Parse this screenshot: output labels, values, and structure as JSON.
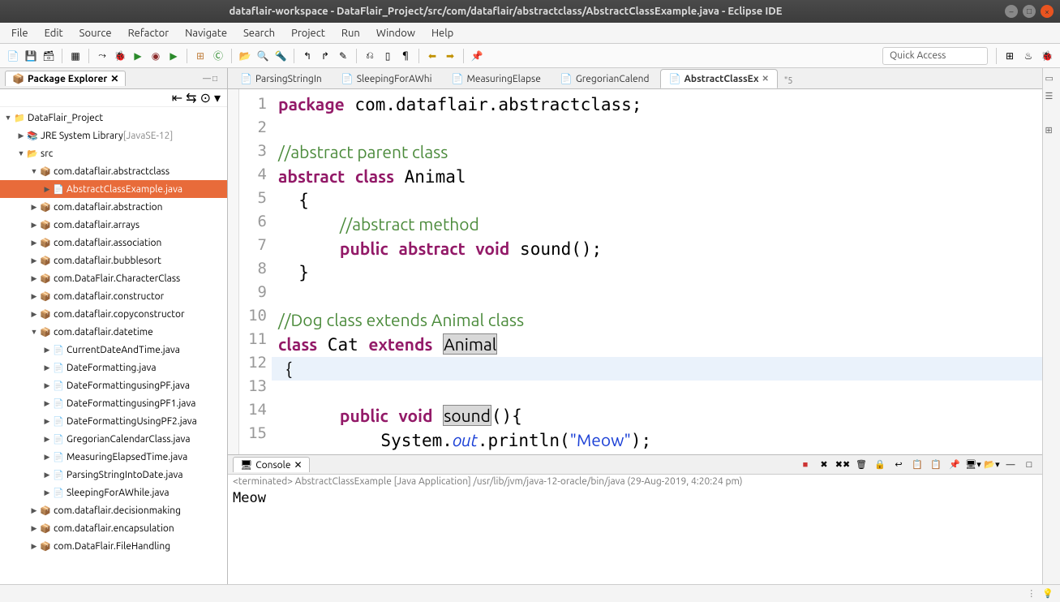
{
  "title": "dataflair-workspace - DataFlair_Project/src/com/dataflair/abstractclass/AbstractClassExample.java - Eclipse IDE",
  "menu": [
    "File",
    "Edit",
    "Source",
    "Refactor",
    "Navigate",
    "Search",
    "Project",
    "Run",
    "Window",
    "Help"
  ],
  "quick_access_placeholder": "Quick Access",
  "package_explorer": {
    "title": "Package Explorer",
    "tree": [
      {
        "d": 0,
        "tw": "▼",
        "ic": "prj",
        "label": "DataFlair_Project"
      },
      {
        "d": 1,
        "tw": "▶",
        "ic": "lib",
        "label": "JRE System Library ",
        "suffix": "[JavaSE-12]"
      },
      {
        "d": 1,
        "tw": "▼",
        "ic": "src",
        "label": "src"
      },
      {
        "d": 2,
        "tw": "▼",
        "ic": "pkg",
        "label": "com.dataflair.abstractclass"
      },
      {
        "d": 3,
        "tw": "▶",
        "ic": "java",
        "label": "AbstractClassExample.java",
        "sel": true
      },
      {
        "d": 2,
        "tw": "▶",
        "ic": "pkg",
        "label": "com.dataflair.abstraction"
      },
      {
        "d": 2,
        "tw": "▶",
        "ic": "pkg",
        "label": "com.dataflair.arrays"
      },
      {
        "d": 2,
        "tw": "▶",
        "ic": "pkg",
        "label": "com.dataflair.association"
      },
      {
        "d": 2,
        "tw": "▶",
        "ic": "pkg",
        "label": "com.dataflair.bubblesort"
      },
      {
        "d": 2,
        "tw": "▶",
        "ic": "pkg",
        "label": "com.DataFlair.CharacterClass"
      },
      {
        "d": 2,
        "tw": "▶",
        "ic": "pkg",
        "label": "com.dataflair.constructor"
      },
      {
        "d": 2,
        "tw": "▶",
        "ic": "pkg",
        "label": "com.dataflair.copyconstructor"
      },
      {
        "d": 2,
        "tw": "▼",
        "ic": "pkg",
        "label": "com.dataflair.datetime"
      },
      {
        "d": 3,
        "tw": "▶",
        "ic": "java",
        "label": "CurrentDateAndTime.java"
      },
      {
        "d": 3,
        "tw": "▶",
        "ic": "java",
        "label": "DateFormatting.java"
      },
      {
        "d": 3,
        "tw": "▶",
        "ic": "java",
        "label": "DateFormattingusingPF.java"
      },
      {
        "d": 3,
        "tw": "▶",
        "ic": "java",
        "label": "DateFormattingusingPF1.java"
      },
      {
        "d": 3,
        "tw": "▶",
        "ic": "java",
        "label": "DateFormattingUsingPF2.java"
      },
      {
        "d": 3,
        "tw": "▶",
        "ic": "java",
        "label": "GregorianCalendarClass.java"
      },
      {
        "d": 3,
        "tw": "▶",
        "ic": "java",
        "label": "MeasuringElapsedTime.java"
      },
      {
        "d": 3,
        "tw": "▶",
        "ic": "java",
        "label": "ParsingStringIntoDate.java"
      },
      {
        "d": 3,
        "tw": "▶",
        "ic": "java",
        "label": "SleepingForAWhile.java"
      },
      {
        "d": 2,
        "tw": "▶",
        "ic": "pkg",
        "label": "com.dataflair.decisionmaking"
      },
      {
        "d": 2,
        "tw": "▶",
        "ic": "pkg",
        "label": "com.dataflair.encapsulation"
      },
      {
        "d": 2,
        "tw": "▶",
        "ic": "pkg",
        "label": "com.DataFlair.FileHandling"
      }
    ]
  },
  "editor": {
    "tabs": [
      {
        "label": "ParsingStringIn"
      },
      {
        "label": "SleepingForAWhi"
      },
      {
        "label": "MeasuringElapse"
      },
      {
        "label": "GregorianCalend"
      },
      {
        "label": "AbstractClassEx",
        "active": true
      }
    ],
    "overflow": "\"5",
    "lines": 15
  },
  "console": {
    "title": "Console",
    "header": "<terminated> AbstractClassExample [Java Application] /usr/lib/jvm/java-12-oracle/bin/java (29-Aug-2019, 4:20:24 pm)",
    "output": "Meow"
  }
}
